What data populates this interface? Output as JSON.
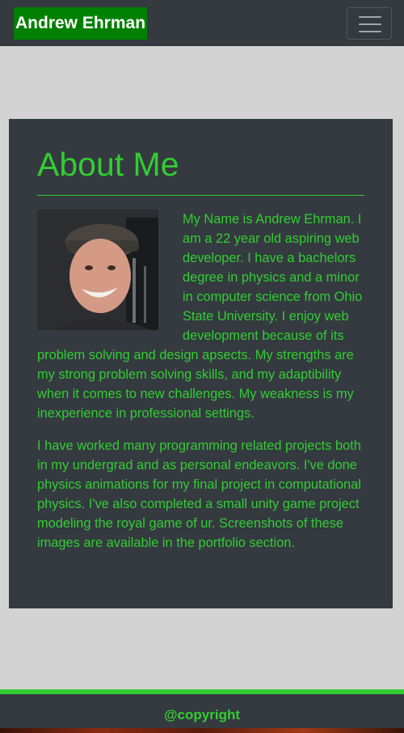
{
  "navbar": {
    "brand": "Andrew Ehrman",
    "toggler_icon": "hamburger-menu-icon"
  },
  "about": {
    "title": "About Me",
    "photo_icon": "profile-photo",
    "paragraphs": [
      "My Name is Andrew Ehrman. I am a 22 year old aspiring web developer. I have a bachelors degree in physics and a minor in computer science from Ohio State University. I enjoy web development because of its problem solving and design apsects. My strengths are my strong problem solving skills, and my adaptibility when it comes to new challenges. My weakness is my inexperience in professional settings.",
      "I have worked many programming related projects both in my undergrad and as personal endeavors. I've done physics animations for my final project in computational physics. I've also completed a small unity game project modeling the royal game of ur. Screenshots of these images are available in the portfolio section."
    ]
  },
  "footer": {
    "copyright": "@copyright"
  },
  "colors": {
    "accent": "#32cd32",
    "brand_bg": "#008000",
    "dark": "#343a40",
    "page_bg": "#d3d3d3"
  }
}
